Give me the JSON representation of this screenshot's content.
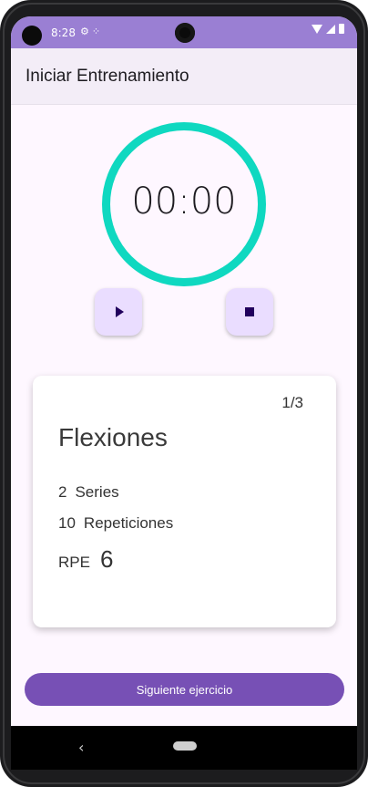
{
  "status_bar": {
    "time": "8:28",
    "left_icons": [
      "settings-icon",
      "dots-icon"
    ],
    "right_icons": [
      "wifi-icon",
      "signal-icon",
      "battery-icon"
    ]
  },
  "app_bar": {
    "title": "Iniciar Entrenamiento"
  },
  "timer": {
    "display": "00:00",
    "ring_color": "#0fd8c0"
  },
  "controls": {
    "play_icon": "play-icon",
    "stop_icon": "stop-icon"
  },
  "exercise_card": {
    "counter": "1/3",
    "name": "Flexiones",
    "series_value": "2",
    "series_label": "Series",
    "reps_value": "10",
    "reps_label": "Repeticiones",
    "rpe_label": "RPE",
    "rpe_value": "6"
  },
  "next_button": {
    "label": "Siguiente ejercicio",
    "color": "#7750b5"
  },
  "nav_bar": {
    "back_glyph": "‹"
  },
  "theme": {
    "status_bar": "#9a7fd3",
    "app_bar": "#f3edf7",
    "button_container": "#eaddff",
    "background": "#fef7ff"
  }
}
